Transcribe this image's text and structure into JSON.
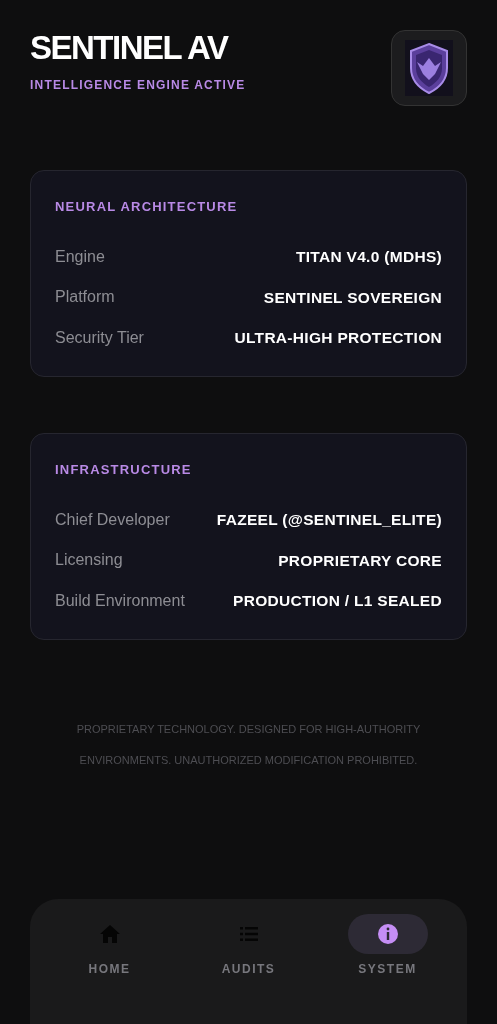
{
  "header": {
    "title": "SENTINEL AV",
    "subtitle": "INTELLIGENCE ENGINE ACTIVE"
  },
  "cards": [
    {
      "title": "NEURAL ARCHITECTURE",
      "rows": [
        {
          "label": "Engine",
          "value": "TITAN V4.0 (MDHS)"
        },
        {
          "label": "Platform",
          "value": "SENTINEL SOVEREIGN"
        },
        {
          "label": "Security Tier",
          "value": "ULTRA-HIGH PROTECTION"
        }
      ]
    },
    {
      "title": "INFRASTRUCTURE",
      "rows": [
        {
          "label": "Chief Developer",
          "value": "FAZEEL (@SENTINEL_ELITE)"
        },
        {
          "label": "Licensing",
          "value": "PROPRIETARY CORE"
        },
        {
          "label": "Build Environment",
          "value": "PRODUCTION / L1 SEALED"
        }
      ]
    }
  ],
  "footer_note": "PROPRIETARY TECHNOLOGY. DESIGNED FOR HIGH-AUTHORITY ENVIRONMENTS. UNAUTHORIZED MODIFICATION PROHIBITED.",
  "nav": [
    {
      "label": "HOME",
      "selected": false
    },
    {
      "label": "AUDITS",
      "selected": false
    },
    {
      "label": "SYSTEM",
      "selected": true
    }
  ]
}
